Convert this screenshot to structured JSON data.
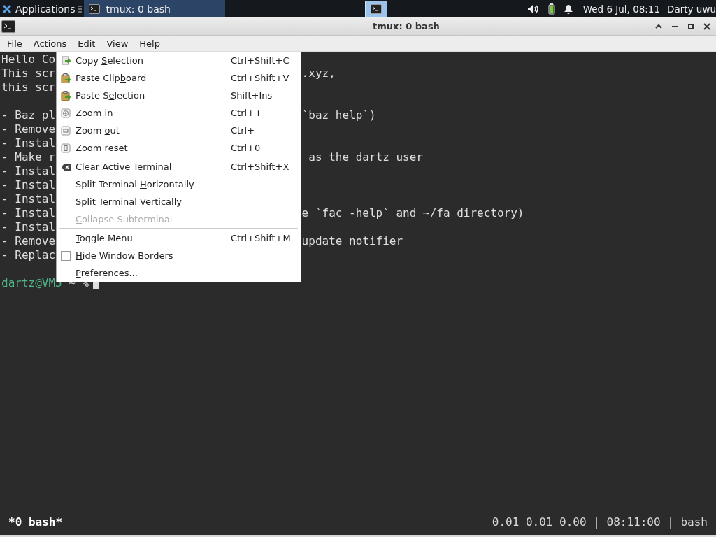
{
  "panel": {
    "apps_label": "Applications",
    "tasks": [
      {
        "label": "tmux: 0 bash",
        "selected": true
      }
    ],
    "clock": "Wed  6 Jul, 08:11",
    "user": "Darty uwu"
  },
  "window": {
    "title": "tmux: 0 bash"
  },
  "menubar": [
    "File",
    "Actions",
    "Edit",
    "View",
    "Help"
  ],
  "terminal": {
    "lines": [
      {
        "kind": "text",
        "left": "Hello Co"
      },
      {
        "kind": "text",
        "left": "This scr",
        "right": ".xyz,"
      },
      {
        "kind": "text",
        "left": "this scr"
      },
      {
        "kind": "blank"
      },
      {
        "kind": "text",
        "left": "- Baz pl",
        "right": "`baz help`)"
      },
      {
        "kind": "text",
        "left": "- Remove"
      },
      {
        "kind": "text",
        "left": "- Instal"
      },
      {
        "kind": "text",
        "left": "- Make r",
        "right": " as the dartz user"
      },
      {
        "kind": "text",
        "left": "- Instal"
      },
      {
        "kind": "text",
        "left": "- Instal"
      },
      {
        "kind": "text",
        "left": "- Instal"
      },
      {
        "kind": "text",
        "left": "- Instal",
        "right": "e `fac -help` and ~/fa directory)"
      },
      {
        "kind": "text",
        "left": "- Instal"
      },
      {
        "kind": "text",
        "left": "- Remove",
        "right": "update notifier"
      },
      {
        "kind": "text",
        "left": "- Replac"
      },
      {
        "kind": "blank"
      }
    ],
    "prompt": {
      "user_host": "dartz@VM5",
      "rest": " ~ %"
    }
  },
  "menu": [
    {
      "kind": "copy",
      "label": {
        "before": "Copy ",
        "key": "S",
        "after": "election"
      },
      "shortcut": "Ctrl+Shift+C",
      "disabled": false
    },
    {
      "kind": "paste",
      "label": {
        "before": "Paste Clip",
        "key": "b",
        "after": "oard"
      },
      "shortcut": "Ctrl+Shift+V",
      "disabled": false
    },
    {
      "kind": "paste",
      "label": {
        "before": "Paste S",
        "key": "e",
        "after": "lection"
      },
      "shortcut": "Shift+Ins",
      "disabled": false
    },
    {
      "kind": "zoomin",
      "label": {
        "before": "Zoom ",
        "key": "i",
        "after": "n"
      },
      "shortcut": "Ctrl++",
      "disabled": false
    },
    {
      "kind": "zoomout",
      "label": {
        "before": "Zoom ",
        "key": "o",
        "after": "ut"
      },
      "shortcut": "Ctrl+-",
      "disabled": false
    },
    {
      "kind": "zoomreset",
      "label": {
        "before": "Zoom rese",
        "key": "t"
      },
      "shortcut": "Ctrl+0",
      "disabled": false
    },
    {
      "kind": "separator"
    },
    {
      "kind": "clear",
      "label": {
        "key": "C",
        "after": "lear Active Terminal"
      },
      "shortcut": "Ctrl+Shift+X",
      "disabled": false
    },
    {
      "kind": "plain",
      "label": {
        "before": "Split Terminal ",
        "key": "H",
        "after": "orizontally"
      },
      "disabled": false
    },
    {
      "kind": "plain",
      "label": {
        "before": "Split Terminal ",
        "key": "V",
        "after": "ertically"
      },
      "disabled": false
    },
    {
      "kind": "plain",
      "label": {
        "key": "C",
        "after": "ollapse Subterminal"
      },
      "disabled": true
    },
    {
      "kind": "separator"
    },
    {
      "kind": "plain",
      "label": {
        "key": "T",
        "after": "oggle Menu"
      },
      "shortcut": "Ctrl+Shift+M",
      "disabled": false
    },
    {
      "kind": "checkbox",
      "label": {
        "key": "H",
        "after": "ide Window Borders"
      },
      "checked": false,
      "disabled": false
    },
    {
      "kind": "plain",
      "label": {
        "key": "P",
        "after": "references..."
      },
      "disabled": false
    }
  ],
  "status": {
    "left": "*0 bash*",
    "right": "0.01 0.01 0.00 | 08:11:00 | bash"
  }
}
